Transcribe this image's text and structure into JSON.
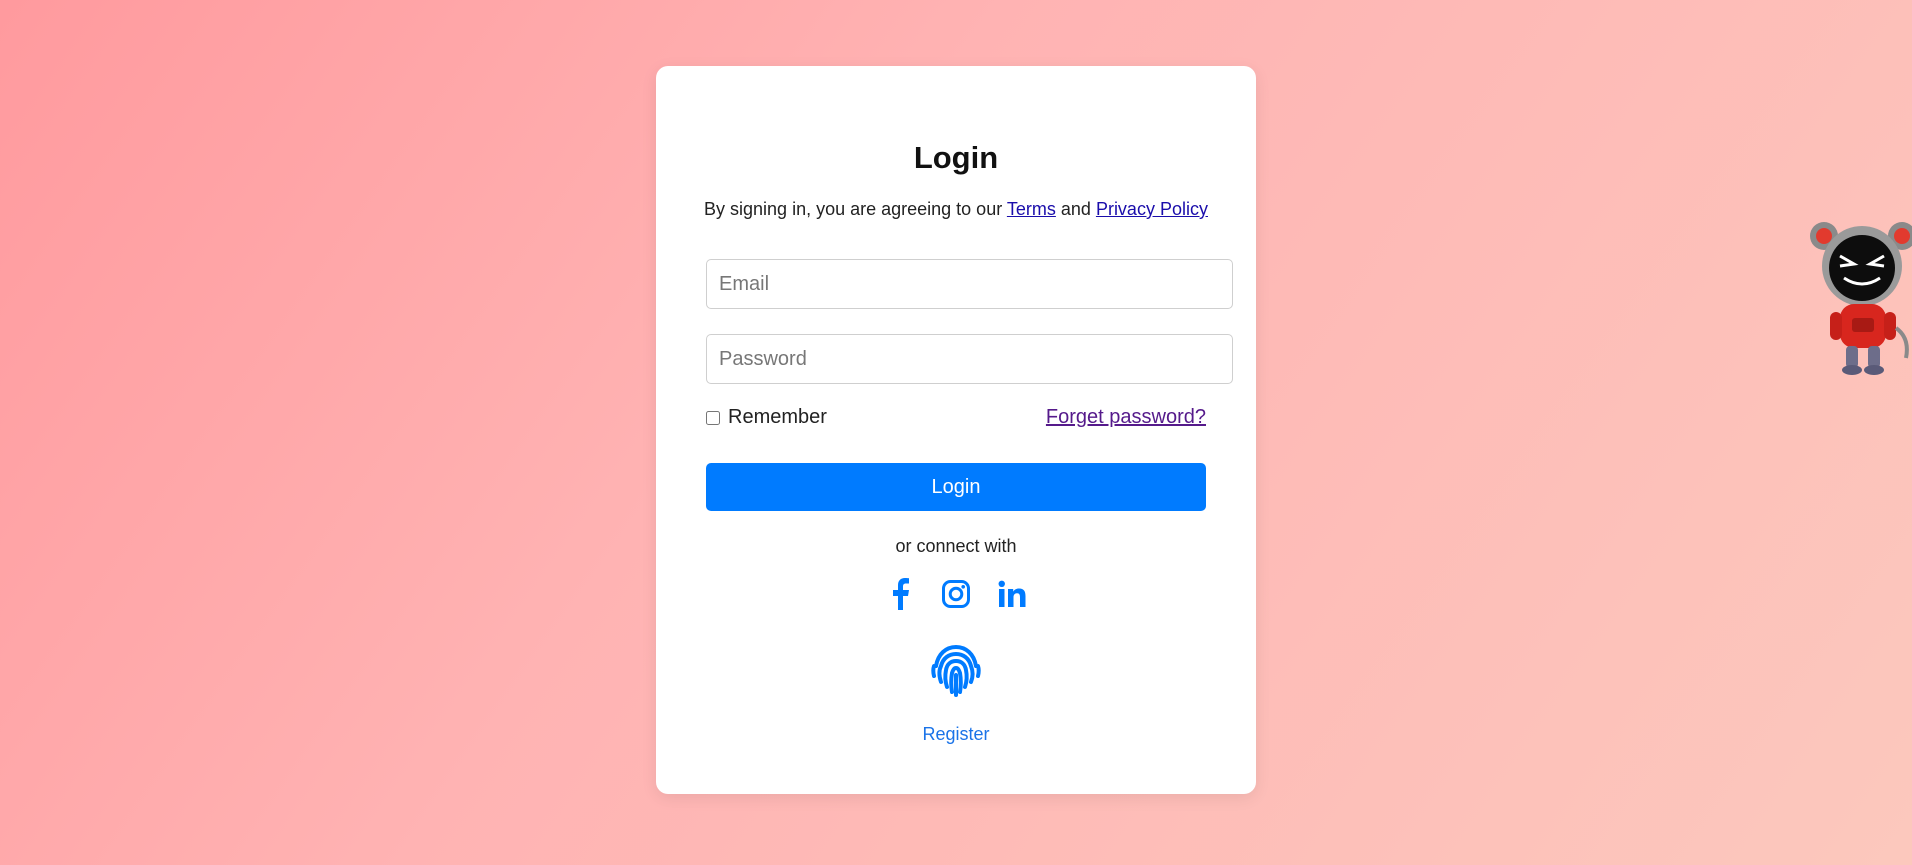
{
  "login": {
    "title": "Login",
    "agreement_prefix": "By signing in, you are agreeing to our ",
    "terms_link": "Terms",
    "agreement_and": " and ",
    "privacy_link": "Privacy Policy",
    "email_placeholder": "Email",
    "password_placeholder": "Password",
    "remember_label": "Remember",
    "forget_link": "Forget password?",
    "login_button": "Login",
    "connect_text": "or connect with",
    "register_link": "Register"
  },
  "socials": [
    {
      "icon": "facebook-icon"
    },
    {
      "icon": "instagram-icon"
    },
    {
      "icon": "linkedin-icon"
    }
  ],
  "colors": {
    "accent": "#007bff",
    "link": "#1a0dab",
    "visited_link": "#551a8b",
    "register_link": "#1a73e8",
    "background_start": "#ff9a9e",
    "background_end": "#fcc8bd"
  }
}
